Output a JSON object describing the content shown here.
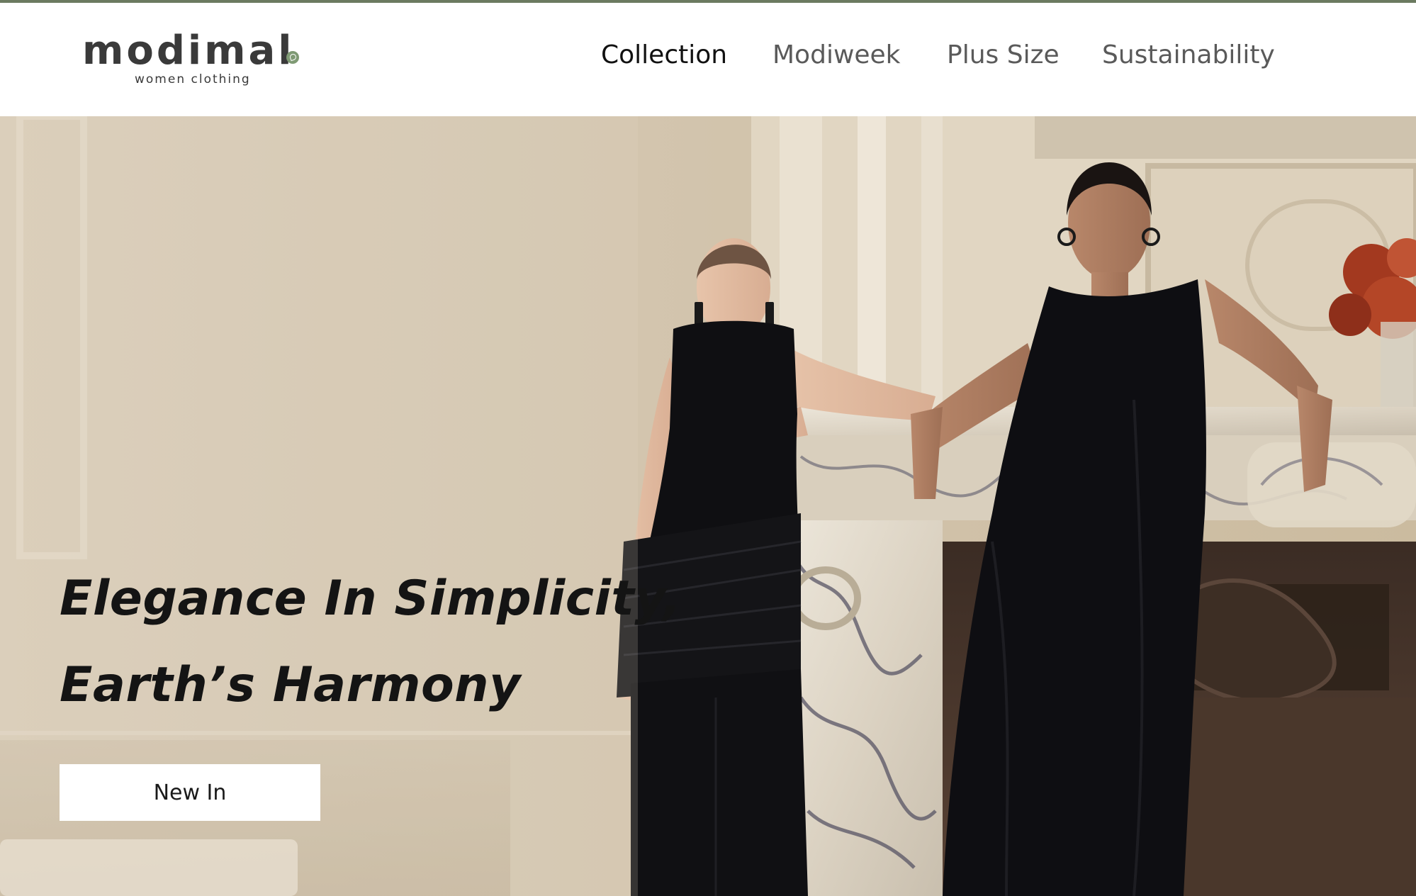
{
  "brand": {
    "name": "modimal",
    "tagline": "women clothing",
    "accent_color": "#7f9a74",
    "topbar_color": "#6b7a60"
  },
  "nav": {
    "items": [
      {
        "label": "Collection",
        "active": true
      },
      {
        "label": "Modiweek",
        "active": false
      },
      {
        "label": "Plus Size",
        "active": false
      },
      {
        "label": "Sustainability",
        "active": false
      }
    ]
  },
  "hero": {
    "headline_line1": "Elegance In Simplicity,",
    "headline_line2": "Earth’s Harmony",
    "cta_label": "New In",
    "photo_subject": "two-models-black-dresses-marble-fireplace"
  }
}
